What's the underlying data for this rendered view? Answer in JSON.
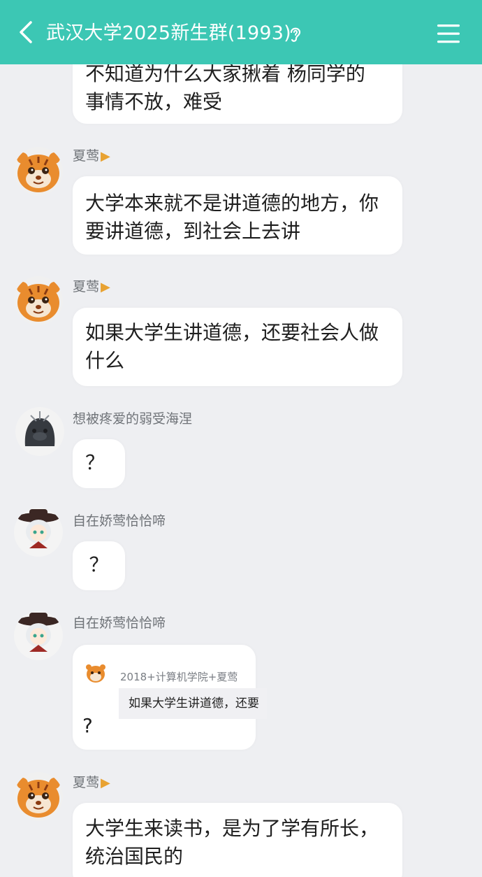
{
  "header": {
    "title": "武汉大学2025新生群(1993)",
    "back_icon": "chevron-left-icon",
    "ear_icon": "ear-icon",
    "menu_icon": "hamburger-menu-icon",
    "bg_color": "#3cc7b4"
  },
  "messages": [
    {
      "text_lines": [
        "不知道为什么大家揪着 杨同学的",
        "事情不放，难受"
      ]
    },
    {
      "sender": "夏莺",
      "text_lines": [
        "大学本来就不是讲道德的地方，你",
        "要讲道德，到社会上去讲"
      ]
    },
    {
      "sender": "夏莺",
      "text_lines": [
        "如果大学生讲道德，还要社会人做",
        "什么"
      ]
    },
    {
      "sender": "想被疼爱的弱受海涅",
      "text_lines": [
        "？"
      ]
    },
    {
      "sender": "自在娇莺恰恰啼",
      "text_lines": [
        "？"
      ]
    },
    {
      "sender": "自在娇莺恰恰啼",
      "quote_sender": "2018+计算机学院+夏莺",
      "quote_text": "如果大学生讲道德，还要",
      "text_lines": [
        "?"
      ]
    },
    {
      "sender": "夏莺",
      "text_lines": [
        "大学生来读书，是为了学有所长，",
        "统治国民的"
      ]
    }
  ]
}
